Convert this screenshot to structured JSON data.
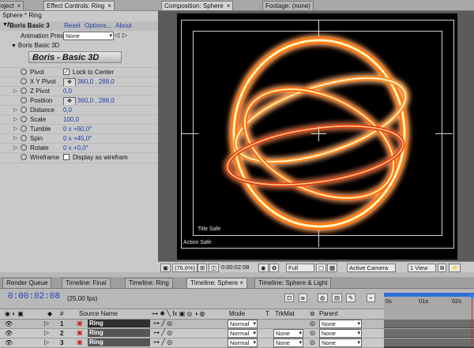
{
  "left_panel": {
    "tabs": [
      {
        "label": "roject",
        "close": "×"
      },
      {
        "label": "Effect Controls: Ring",
        "close": "×"
      }
    ],
    "layer_line": "Sphere * Ring",
    "effect": {
      "fx_label": "f",
      "name": "Boris Basic 3",
      "reset": "Reset",
      "options": "Options...",
      "about": "About"
    },
    "animation_presets": {
      "label": "Animation Pres",
      "value": "None"
    },
    "sub_header": "Boris Basic 3D",
    "logo": "Boris - Basic 3D",
    "properties": [
      {
        "name": "Pivot",
        "checkbox": true,
        "checked": true,
        "text": "Lock to Center"
      },
      {
        "name": "X Y Pivot",
        "point": true,
        "value": "360,0 , 288,0"
      },
      {
        "name": "Z Pivot",
        "value": "0,0"
      },
      {
        "name": "Position",
        "point": true,
        "value": "360,0 , 288,0"
      },
      {
        "name": "Distance",
        "value": "0,0"
      },
      {
        "name": "Scale",
        "value": "100,0"
      },
      {
        "name": "Tumble",
        "value": "0 x +60,0°"
      },
      {
        "name": "Spin",
        "value": "0 x +45,0°"
      },
      {
        "name": "Rotate",
        "value": "0 x +0,0°"
      },
      {
        "name": "Wireframe",
        "checkbox": true,
        "checked": false,
        "text": "Display as wirefram"
      }
    ]
  },
  "composition": {
    "tabs": [
      {
        "label": "Composition: Sphere",
        "close": "×"
      },
      {
        "label": "Footage: (none)",
        "close": ""
      }
    ],
    "title_safe": "Title Safe",
    "action_safe": "Action Safe",
    "bottom_bar": {
      "zoom": "(76,6%)",
      "timecode": "0:00:02:08",
      "resolution": "Full",
      "camera": "Active Camera",
      "view": "1 View"
    }
  },
  "timeline": {
    "tabs": [
      {
        "label": "Render Queue",
        "active": false
      },
      {
        "label": "Timeline: Final",
        "active": false
      },
      {
        "label": "Timeline: Ring",
        "active": false
      },
      {
        "label": "Timeline: Sphere",
        "active": true,
        "close": "×"
      },
      {
        "label": "Timeline: Sphere & Light",
        "active": false
      }
    ],
    "timecode": "0:00:02:08",
    "fps": "(25,00 fps)",
    "columns": {
      "source_name": "Source Name",
      "mode": "Mode",
      "t": "T",
      "trkmat": "TrkMat",
      "parent": "Parent"
    },
    "ruler": [
      "0s",
      "01s",
      "02s"
    ],
    "layers": [
      {
        "num": "1",
        "name": "Ring",
        "mode": "Normal",
        "trkmat": "",
        "parent": "None",
        "selected": true
      },
      {
        "num": "2",
        "name": "Ring",
        "mode": "Normal",
        "trkmat": "None",
        "parent": "None",
        "selected": false
      },
      {
        "num": "3",
        "name": "Ring",
        "mode": "Normal",
        "trkmat": "None",
        "parent": "None",
        "selected": false
      }
    ]
  }
}
